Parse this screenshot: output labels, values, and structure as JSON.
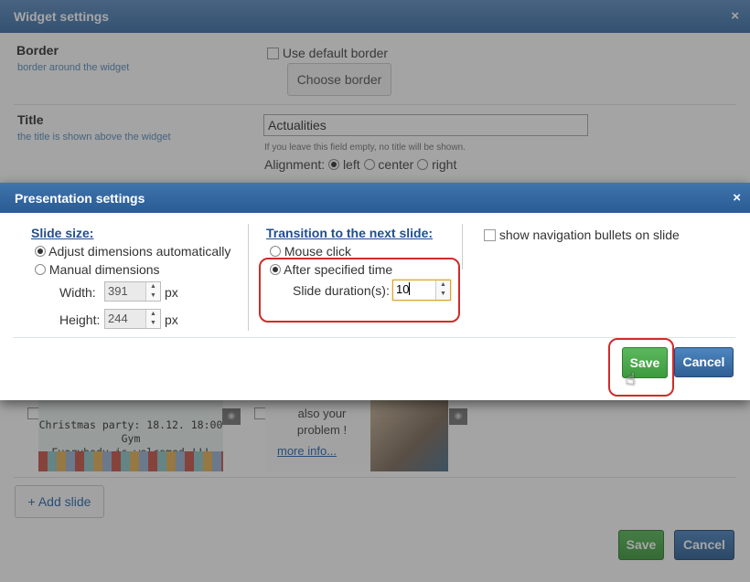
{
  "widget_settings": {
    "title": "Widget settings",
    "close_glyph": "×",
    "border": {
      "label": "Border",
      "sub": "border around the widget",
      "use_default_label": "Use default border",
      "choose_button": "Choose border"
    },
    "title_field": {
      "label": "Title",
      "sub": "the title is shown above the widget",
      "value": "Actualities",
      "hint": "If you leave this field empty, no title will be shown.",
      "alignment_label": "Alignment:",
      "options": [
        "left",
        "center",
        "right"
      ],
      "selected": "left"
    },
    "slides": [
      {
        "line1": "Christmas party: 18.12. 18:00 Gym",
        "line2": "Everybody is welcomed !!!"
      },
      {
        "line1": "also your",
        "line2": "problem !",
        "link": "more info..."
      }
    ],
    "add_slide_label": "+ Add slide",
    "save_label": "Save",
    "cancel_label": "Cancel"
  },
  "presentation": {
    "title": "Presentation settings",
    "close_glyph": "×",
    "slide_size": {
      "heading": "Slide size:",
      "option_auto": "Adjust dimensions automatically",
      "option_manual": "Manual dimensions",
      "selected": "auto",
      "width_label": "Width:",
      "width_value": "391",
      "height_label": "Height:",
      "height_value": "244",
      "unit": "px"
    },
    "transition": {
      "heading": "Transition to the next slide:",
      "option_click": "Mouse click",
      "option_time": "After specified time",
      "selected": "time",
      "duration_label": "Slide duration(s):",
      "duration_value": "10"
    },
    "nav_bullets_label": "show navigation bullets on slide",
    "save_label": "Save",
    "cancel_label": "Cancel"
  },
  "colors": {
    "header_blue": "#3f74ad",
    "save_green": "#4cae4c",
    "cancel_blue": "#2f5f95",
    "highlight_red": "#d12b2b"
  }
}
